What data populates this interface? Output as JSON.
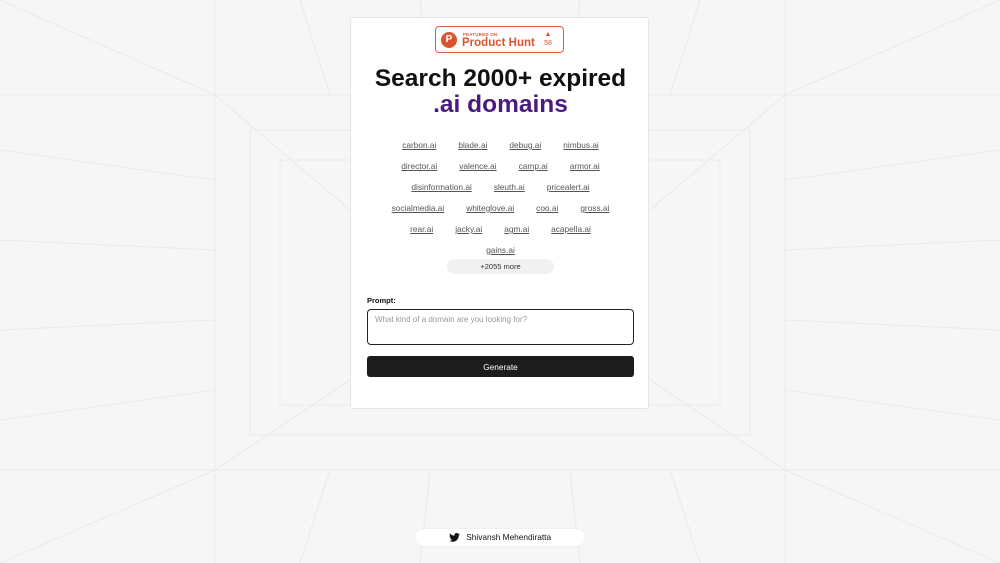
{
  "badge": {
    "featured_text": "FEATURED ON",
    "name": "Product Hunt",
    "logo_letter": "P",
    "upvote_arrow": "▲",
    "votes": "58",
    "color": "#da552f"
  },
  "headline": {
    "line1": "Search 2000+ expired",
    "line2": ".ai domains",
    "accent_color": "#4a1a80"
  },
  "domain_rows": [
    [
      "carbon.ai",
      "blade.ai",
      "debug.ai",
      "nimbus.ai"
    ],
    [
      "director.ai",
      "valence.ai",
      "camp.ai",
      "armor.ai"
    ],
    [
      "disinformation.ai",
      "sleuth.ai",
      "pricealert.ai"
    ],
    [
      "socialmedia.ai",
      "whiteglove.ai",
      "coo.ai",
      "gross.ai"
    ],
    [
      "rear.ai",
      "jacky.ai",
      "agm.ai",
      "acapella.ai"
    ],
    [
      "gains.ai"
    ]
  ],
  "more_button": "+2055 more",
  "prompt": {
    "label": "Prompt:",
    "placeholder": "What kind of a domain are you looking for?",
    "value": ""
  },
  "generate_button": "Generate",
  "footer": {
    "author": "Shivansh Mehendiratta",
    "icon": "twitter-icon"
  }
}
